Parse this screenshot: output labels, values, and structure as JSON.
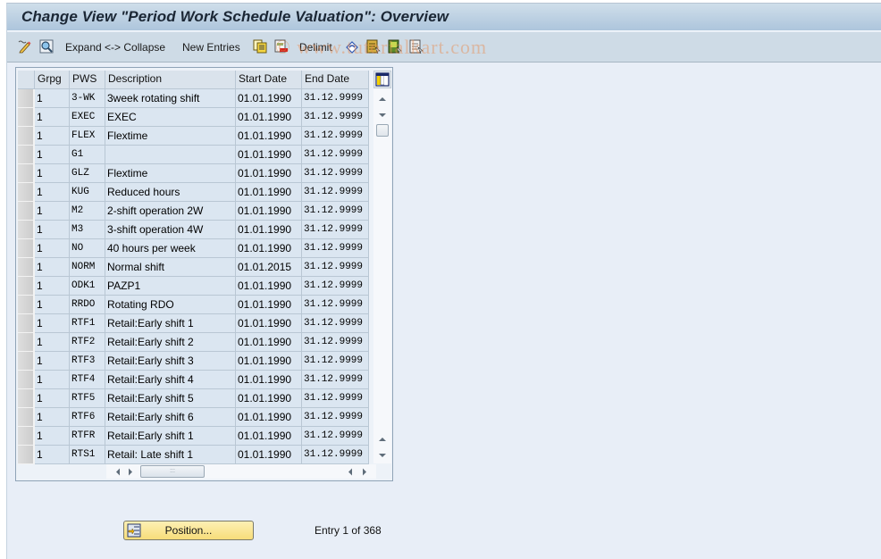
{
  "window": {
    "title": "Change View \"Period Work Schedule Valuation\": Overview"
  },
  "toolbar": {
    "items": [
      {
        "type": "icon",
        "icon": "display-change-icon"
      },
      {
        "type": "icon",
        "icon": "find-icon"
      },
      {
        "type": "button",
        "label": "Expand <-> Collapse"
      },
      {
        "type": "button",
        "label": "New Entries"
      },
      {
        "type": "icon",
        "icon": "copy-as-icon"
      },
      {
        "type": "icon",
        "icon": "delete-icon"
      },
      {
        "type": "button",
        "label": "Delimit"
      },
      {
        "type": "icon",
        "icon": "undo-change-icon"
      },
      {
        "type": "icon",
        "icon": "select-all-icon"
      },
      {
        "type": "icon",
        "icon": "select-block-icon"
      },
      {
        "type": "icon",
        "icon": "deselect-all-icon"
      }
    ],
    "expand_collapse_label": "Expand <-> Collapse",
    "new_entries_label": "New Entries",
    "delimit_label": "Delimit"
  },
  "watermark": "© www.tutorialkart.com",
  "table": {
    "columns": [
      "Grpg",
      "PWS",
      "Description",
      "Start Date",
      "End Date"
    ],
    "rows": [
      {
        "grpg": "1",
        "pws": "3-WK",
        "description": "3week rotating shift",
        "start": "01.01.1990",
        "end": "31.12.9999"
      },
      {
        "grpg": "1",
        "pws": "EXEC",
        "description": "EXEC",
        "start": "01.01.1990",
        "end": "31.12.9999"
      },
      {
        "grpg": "1",
        "pws": "FLEX",
        "description": "Flextime",
        "start": "01.01.1990",
        "end": "31.12.9999"
      },
      {
        "grpg": "1",
        "pws": "G1",
        "description": "",
        "start": "01.01.1990",
        "end": "31.12.9999"
      },
      {
        "grpg": "1",
        "pws": "GLZ",
        "description": "Flextime",
        "start": "01.01.1990",
        "end": "31.12.9999"
      },
      {
        "grpg": "1",
        "pws": "KUG",
        "description": "Reduced hours",
        "start": "01.01.1990",
        "end": "31.12.9999"
      },
      {
        "grpg": "1",
        "pws": "M2",
        "description": "2-shift operation 2W",
        "start": "01.01.1990",
        "end": "31.12.9999"
      },
      {
        "grpg": "1",
        "pws": "M3",
        "description": "3-shift operation 4W",
        "start": "01.01.1990",
        "end": "31.12.9999"
      },
      {
        "grpg": "1",
        "pws": "NO",
        "description": "40 hours per week",
        "start": "01.01.1990",
        "end": "31.12.9999"
      },
      {
        "grpg": "1",
        "pws": "NORM",
        "description": "Normal shift",
        "start": "01.01.2015",
        "end": "31.12.9999"
      },
      {
        "grpg": "1",
        "pws": "ODK1",
        "description": "PAZP1",
        "start": "01.01.1990",
        "end": "31.12.9999"
      },
      {
        "grpg": "1",
        "pws": "RRDO",
        "description": "Rotating RDO",
        "start": "01.01.1990",
        "end": "31.12.9999"
      },
      {
        "grpg": "1",
        "pws": "RTF1",
        "description": "Retail:Early shift 1",
        "start": "01.01.1990",
        "end": "31.12.9999"
      },
      {
        "grpg": "1",
        "pws": "RTF2",
        "description": "Retail:Early shift 2",
        "start": "01.01.1990",
        "end": "31.12.9999"
      },
      {
        "grpg": "1",
        "pws": "RTF3",
        "description": "Retail:Early shift 3",
        "start": "01.01.1990",
        "end": "31.12.9999"
      },
      {
        "grpg": "1",
        "pws": "RTF4",
        "description": "Retail:Early shift 4",
        "start": "01.01.1990",
        "end": "31.12.9999"
      },
      {
        "grpg": "1",
        "pws": "RTF5",
        "description": "Retail:Early shift 5",
        "start": "01.01.1990",
        "end": "31.12.9999"
      },
      {
        "grpg": "1",
        "pws": "RTF6",
        "description": "Retail:Early shift 6",
        "start": "01.01.1990",
        "end": "31.12.9999"
      },
      {
        "grpg": "1",
        "pws": "RTFR",
        "description": "Retail:Early shift 1",
        "start": "01.01.1990",
        "end": "31.12.9999"
      },
      {
        "grpg": "1",
        "pws": "RTS1",
        "description": "Retail: Late shift 1",
        "start": "01.01.1990",
        "end": "31.12.9999"
      }
    ]
  },
  "footer": {
    "position_label": "Position...",
    "entry_info": "Entry 1 of 368"
  },
  "colors": {
    "title_bar": "#b9cfe3",
    "toolbar": "#cedbe6",
    "background": "#e8eef7",
    "cell": "#dbe6f1",
    "position_button": "#f9e390"
  }
}
